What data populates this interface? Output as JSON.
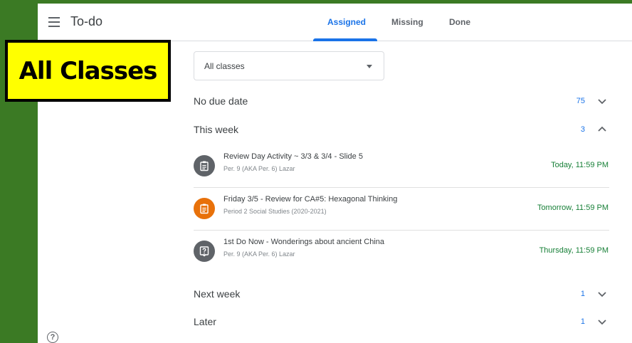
{
  "header": {
    "app_title": "To-do",
    "tabs": [
      {
        "label": "Assigned",
        "active": true
      },
      {
        "label": "Missing",
        "active": false
      },
      {
        "label": "Done",
        "active": false
      }
    ]
  },
  "callout": {
    "text": "All Classes"
  },
  "filter": {
    "selected": "All classes"
  },
  "sections": {
    "no_due_date": {
      "title": "No due date",
      "count": "75",
      "expanded": false
    },
    "this_week": {
      "title": "This week",
      "count": "3",
      "expanded": true
    },
    "next_week": {
      "title": "Next week",
      "count": "1",
      "expanded": false
    },
    "later": {
      "title": "Later",
      "count": "1",
      "expanded": false
    }
  },
  "items": [
    {
      "title": "Review Day Activity ~ 3/3 & 3/4 - Slide 5",
      "class": "Per. 9 (AKA Per. 6) Lazar",
      "due": "Today, 11:59 PM",
      "icon": "assignment-icon",
      "icon_color": "#5f6368"
    },
    {
      "title": "Friday 3/5 - Review for CA#5: Hexagonal Thinking",
      "class": "Period 2 Social Studies (2020-2021)",
      "due": "Tomorrow, 11:59 PM",
      "icon": "assignment-icon",
      "icon_color": "#e8710a"
    },
    {
      "title": "1st Do Now - Wonderings about ancient China",
      "class": "Per. 9 (AKA Per. 6) Lazar",
      "due": "Thursday, 11:59 PM",
      "icon": "question-icon",
      "icon_color": "#5f6368"
    }
  ],
  "colors": {
    "accent": "#1a73e8",
    "due": "#188038",
    "frame": "#3b7a24",
    "callout_bg": "#ffff00"
  }
}
